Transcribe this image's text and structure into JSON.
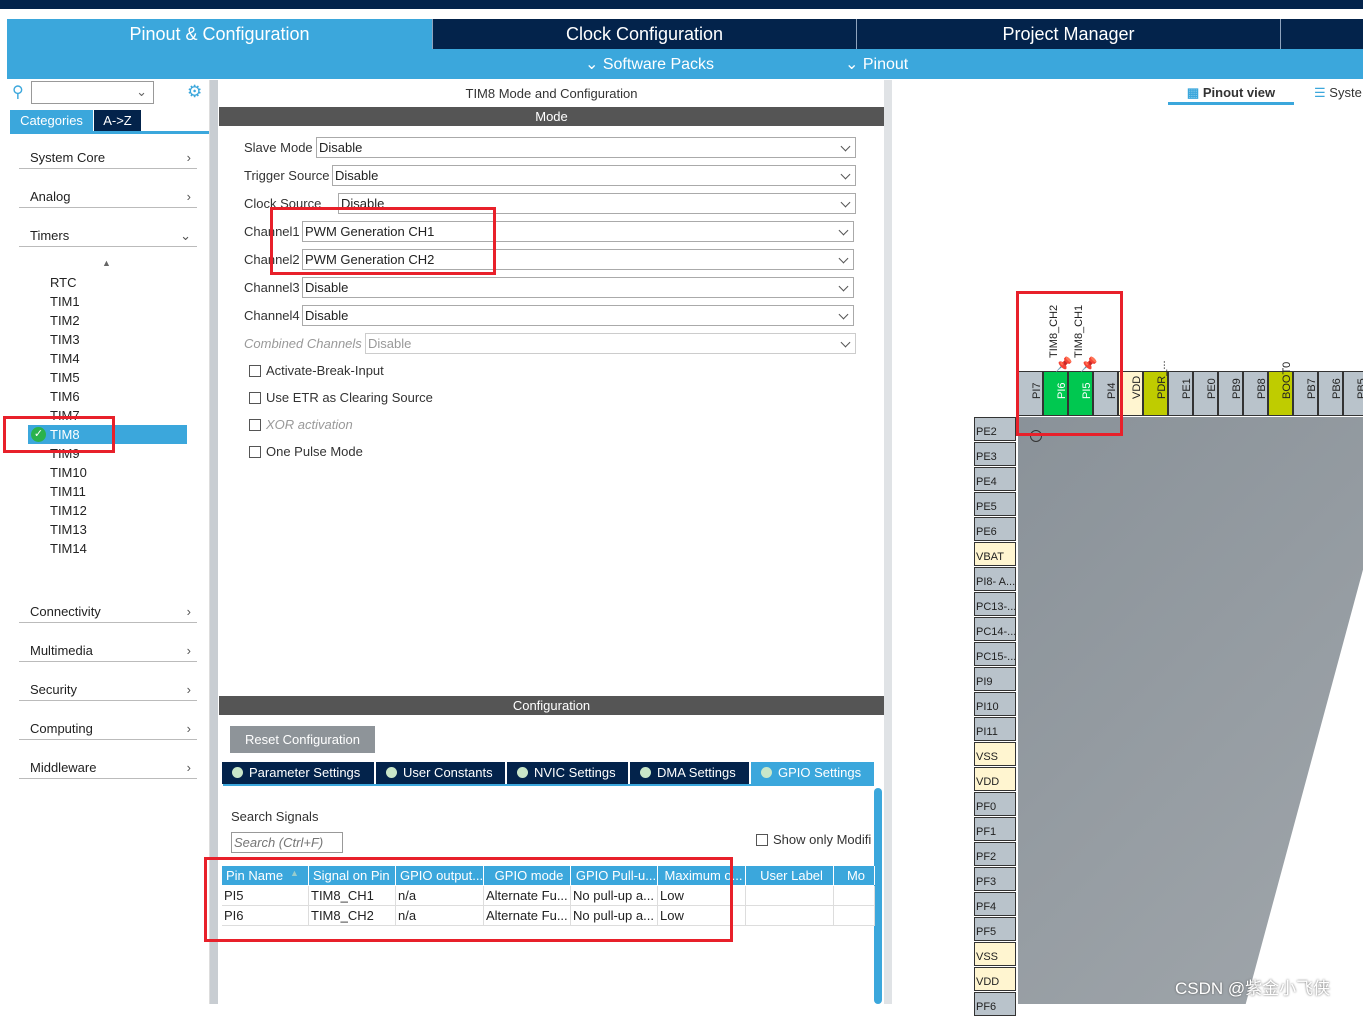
{
  "tabs": [
    {
      "label": "Pinout & Configuration",
      "active": true
    },
    {
      "label": "Clock Configuration"
    },
    {
      "label": "Project Manager"
    }
  ],
  "subbar": {
    "software_packs": "Software Packs",
    "pinout": "Pinout"
  },
  "left": {
    "search_placeholder": "",
    "categories_tab": "Categories",
    "az_tab": "A->Z",
    "categories": [
      "System Core",
      "Analog",
      "Timers",
      "Connectivity",
      "Multimedia",
      "Security",
      "Computing",
      "Middleware"
    ],
    "timers": [
      "RTC",
      "TIM1",
      "TIM2",
      "TIM3",
      "TIM4",
      "TIM5",
      "TIM6",
      "TIM7",
      "TIM8",
      "TIM9",
      "TIM10",
      "TIM11",
      "TIM12",
      "TIM13",
      "TIM14"
    ],
    "selected": "TIM8"
  },
  "mode": {
    "title": "TIM8 Mode and Configuration",
    "header": "Mode",
    "fields": [
      {
        "label": "Slave Mode",
        "value": "Disable"
      },
      {
        "label": "Trigger Source",
        "value": "Disable"
      },
      {
        "label": "Clock Source",
        "value": "Disable"
      },
      {
        "label": "Channel1",
        "value": "PWM Generation CH1"
      },
      {
        "label": "Channel2",
        "value": "PWM Generation CH2"
      },
      {
        "label": "Channel3",
        "value": "Disable"
      },
      {
        "label": "Channel4",
        "value": "Disable"
      },
      {
        "label": "Combined Channels",
        "value": "Disable",
        "disabled": true
      }
    ],
    "checkboxes": [
      {
        "label": "Activate-Break-Input",
        "checked": false
      },
      {
        "label": "Use ETR as Clearing Source",
        "checked": false
      },
      {
        "label": "XOR activation",
        "checked": false,
        "disabled": true
      },
      {
        "label": "One Pulse Mode",
        "checked": false
      }
    ]
  },
  "config": {
    "header": "Configuration",
    "reset": "Reset Configuration",
    "tabs": [
      "Parameter Settings",
      "User Constants",
      "NVIC Settings",
      "DMA Settings",
      "GPIO Settings"
    ],
    "active_tab": "GPIO Settings",
    "search_label": "Search Signals",
    "search_placeholder": "Search (Ctrl+F)",
    "show_modified": "Show only Modifi",
    "columns": [
      "Pin Name",
      "Signal on Pin",
      "GPIO output...",
      "GPIO mode",
      "GPIO Pull-u...",
      "Maximum o...",
      "User Label",
      "Mo"
    ],
    "rows": [
      [
        "PI5",
        "TIM8_CH1",
        "n/a",
        "Alternate Fu...",
        "No pull-up a...",
        "Low",
        ""
      ],
      [
        "PI6",
        "TIM8_CH2",
        "n/a",
        "Alternate Fu...",
        "No pull-up a...",
        "Low",
        ""
      ]
    ]
  },
  "pinout": {
    "pinout_view": "Pinout view",
    "system_view": "Syste",
    "top_pins": [
      {
        "name": "PI7",
        "color": "#b9c3cb"
      },
      {
        "name": "PI6",
        "color": "#00c850",
        "signal": "TIM8_CH2"
      },
      {
        "name": "PI5",
        "color": "#00c850",
        "signal": "TIM8_CH1"
      },
      {
        "name": "PI4",
        "color": "#b9c3cb"
      },
      {
        "name": "VDD",
        "color": "#fff5d0"
      },
      {
        "name": "PDR_...",
        "color": "#bfcc00"
      },
      {
        "name": "PE1",
        "color": "#b9c3cb"
      },
      {
        "name": "PE0",
        "color": "#b9c3cb"
      },
      {
        "name": "PB9",
        "color": "#b9c3cb"
      },
      {
        "name": "PB8",
        "color": "#b9c3cb"
      },
      {
        "name": "BOOT0",
        "color": "#bfcc00"
      },
      {
        "name": "PB7",
        "color": "#b9c3cb"
      },
      {
        "name": "PB6",
        "color": "#b9c3cb"
      },
      {
        "name": "PB5",
        "color": "#b9c3cb"
      }
    ],
    "left_pins": [
      {
        "name": "PE2"
      },
      {
        "name": "PE3"
      },
      {
        "name": "PE4"
      },
      {
        "name": "PE5"
      },
      {
        "name": "PE6"
      },
      {
        "name": "VBAT",
        "color": "#fff5d0"
      },
      {
        "name": "PI8- A..."
      },
      {
        "name": "PC13-..."
      },
      {
        "name": "PC14-..."
      },
      {
        "name": "PC15-..."
      },
      {
        "name": "PI9"
      },
      {
        "name": "PI10"
      },
      {
        "name": "PI11"
      },
      {
        "name": "VSS",
        "color": "#fff5d0"
      },
      {
        "name": "VDD",
        "color": "#fff5d0"
      },
      {
        "name": "PF0"
      },
      {
        "name": "PF1"
      },
      {
        "name": "PF2"
      },
      {
        "name": "PF3"
      },
      {
        "name": "PF4"
      },
      {
        "name": "PF5"
      },
      {
        "name": "VSS",
        "color": "#fff5d0"
      },
      {
        "name": "VDD",
        "color": "#fff5d0"
      },
      {
        "name": "PF6"
      }
    ]
  },
  "watermark": "CSDN @紫金小飞侠"
}
